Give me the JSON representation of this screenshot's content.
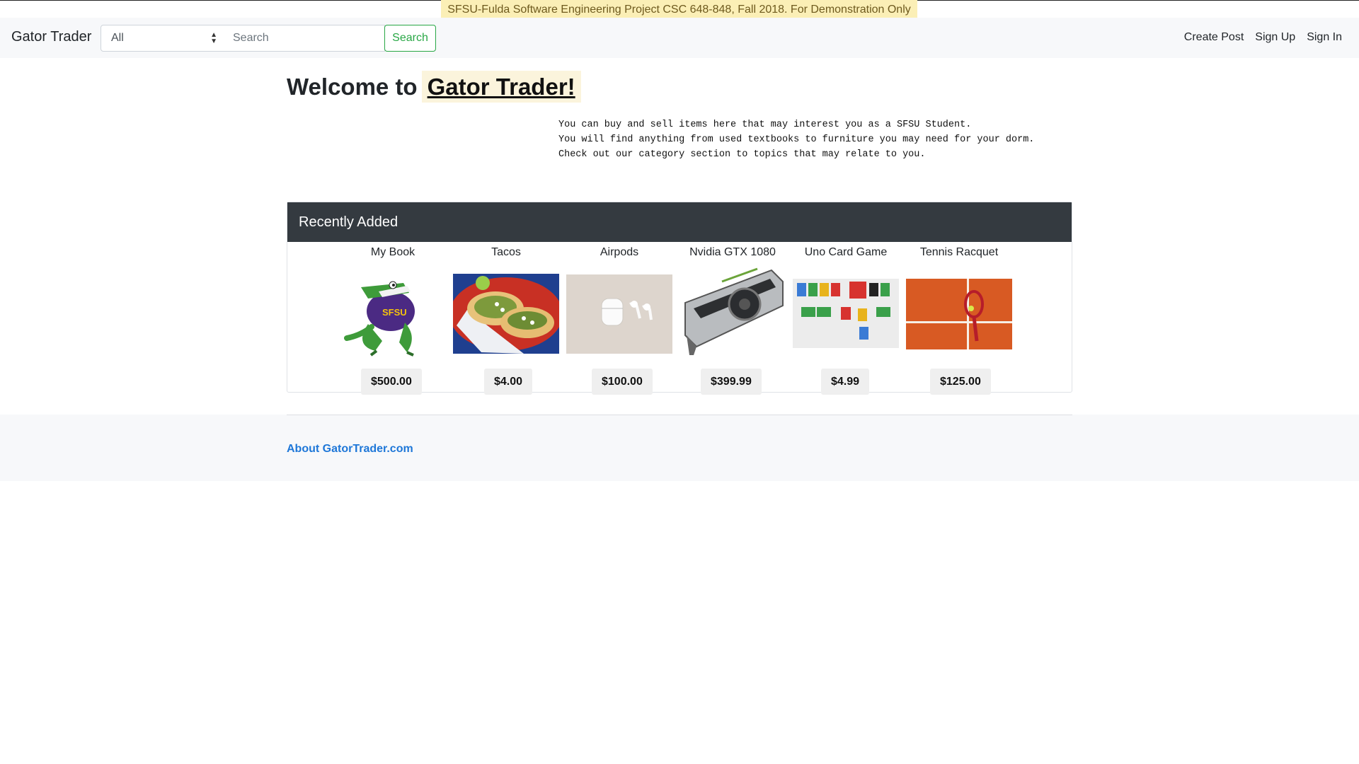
{
  "banner": {
    "text": "SFSU-Fulda Software Engineering Project CSC 648-848, Fall 2018. For Demonstration Only"
  },
  "navbar": {
    "brand": "Gator Trader",
    "category_selected": "All",
    "search_placeholder": "Search",
    "search_button": "Search",
    "links": [
      "Create Post",
      "Sign Up",
      "Sign In"
    ]
  },
  "welcome": {
    "prefix": "Welcome to",
    "highlight": "Gator Trader!",
    "lines": [
      "You can buy and sell items here that may interest you as a SFSU Student.",
      "You will find anything from used textbooks to furniture you may need for your dorm.",
      "Check out our category section to topics that may relate to you."
    ]
  },
  "recent": {
    "header": "Recently Added",
    "items": [
      {
        "title": "My Book",
        "price": "$500.00",
        "icon": "gator-mascot-image"
      },
      {
        "title": "Tacos",
        "price": "$4.00",
        "icon": "tacos-image"
      },
      {
        "title": "Airpods",
        "price": "$100.00",
        "icon": "airpods-image"
      },
      {
        "title": "Nvidia GTX 1080",
        "price": "$399.99",
        "icon": "graphics-card-image"
      },
      {
        "title": "Uno Card Game",
        "price": "$4.99",
        "icon": "uno-cards-image"
      },
      {
        "title": "Tennis Racquet",
        "price": "$125.00",
        "icon": "tennis-racquet-image"
      }
    ]
  },
  "footer": {
    "about_link": "About GatorTrader.com"
  }
}
